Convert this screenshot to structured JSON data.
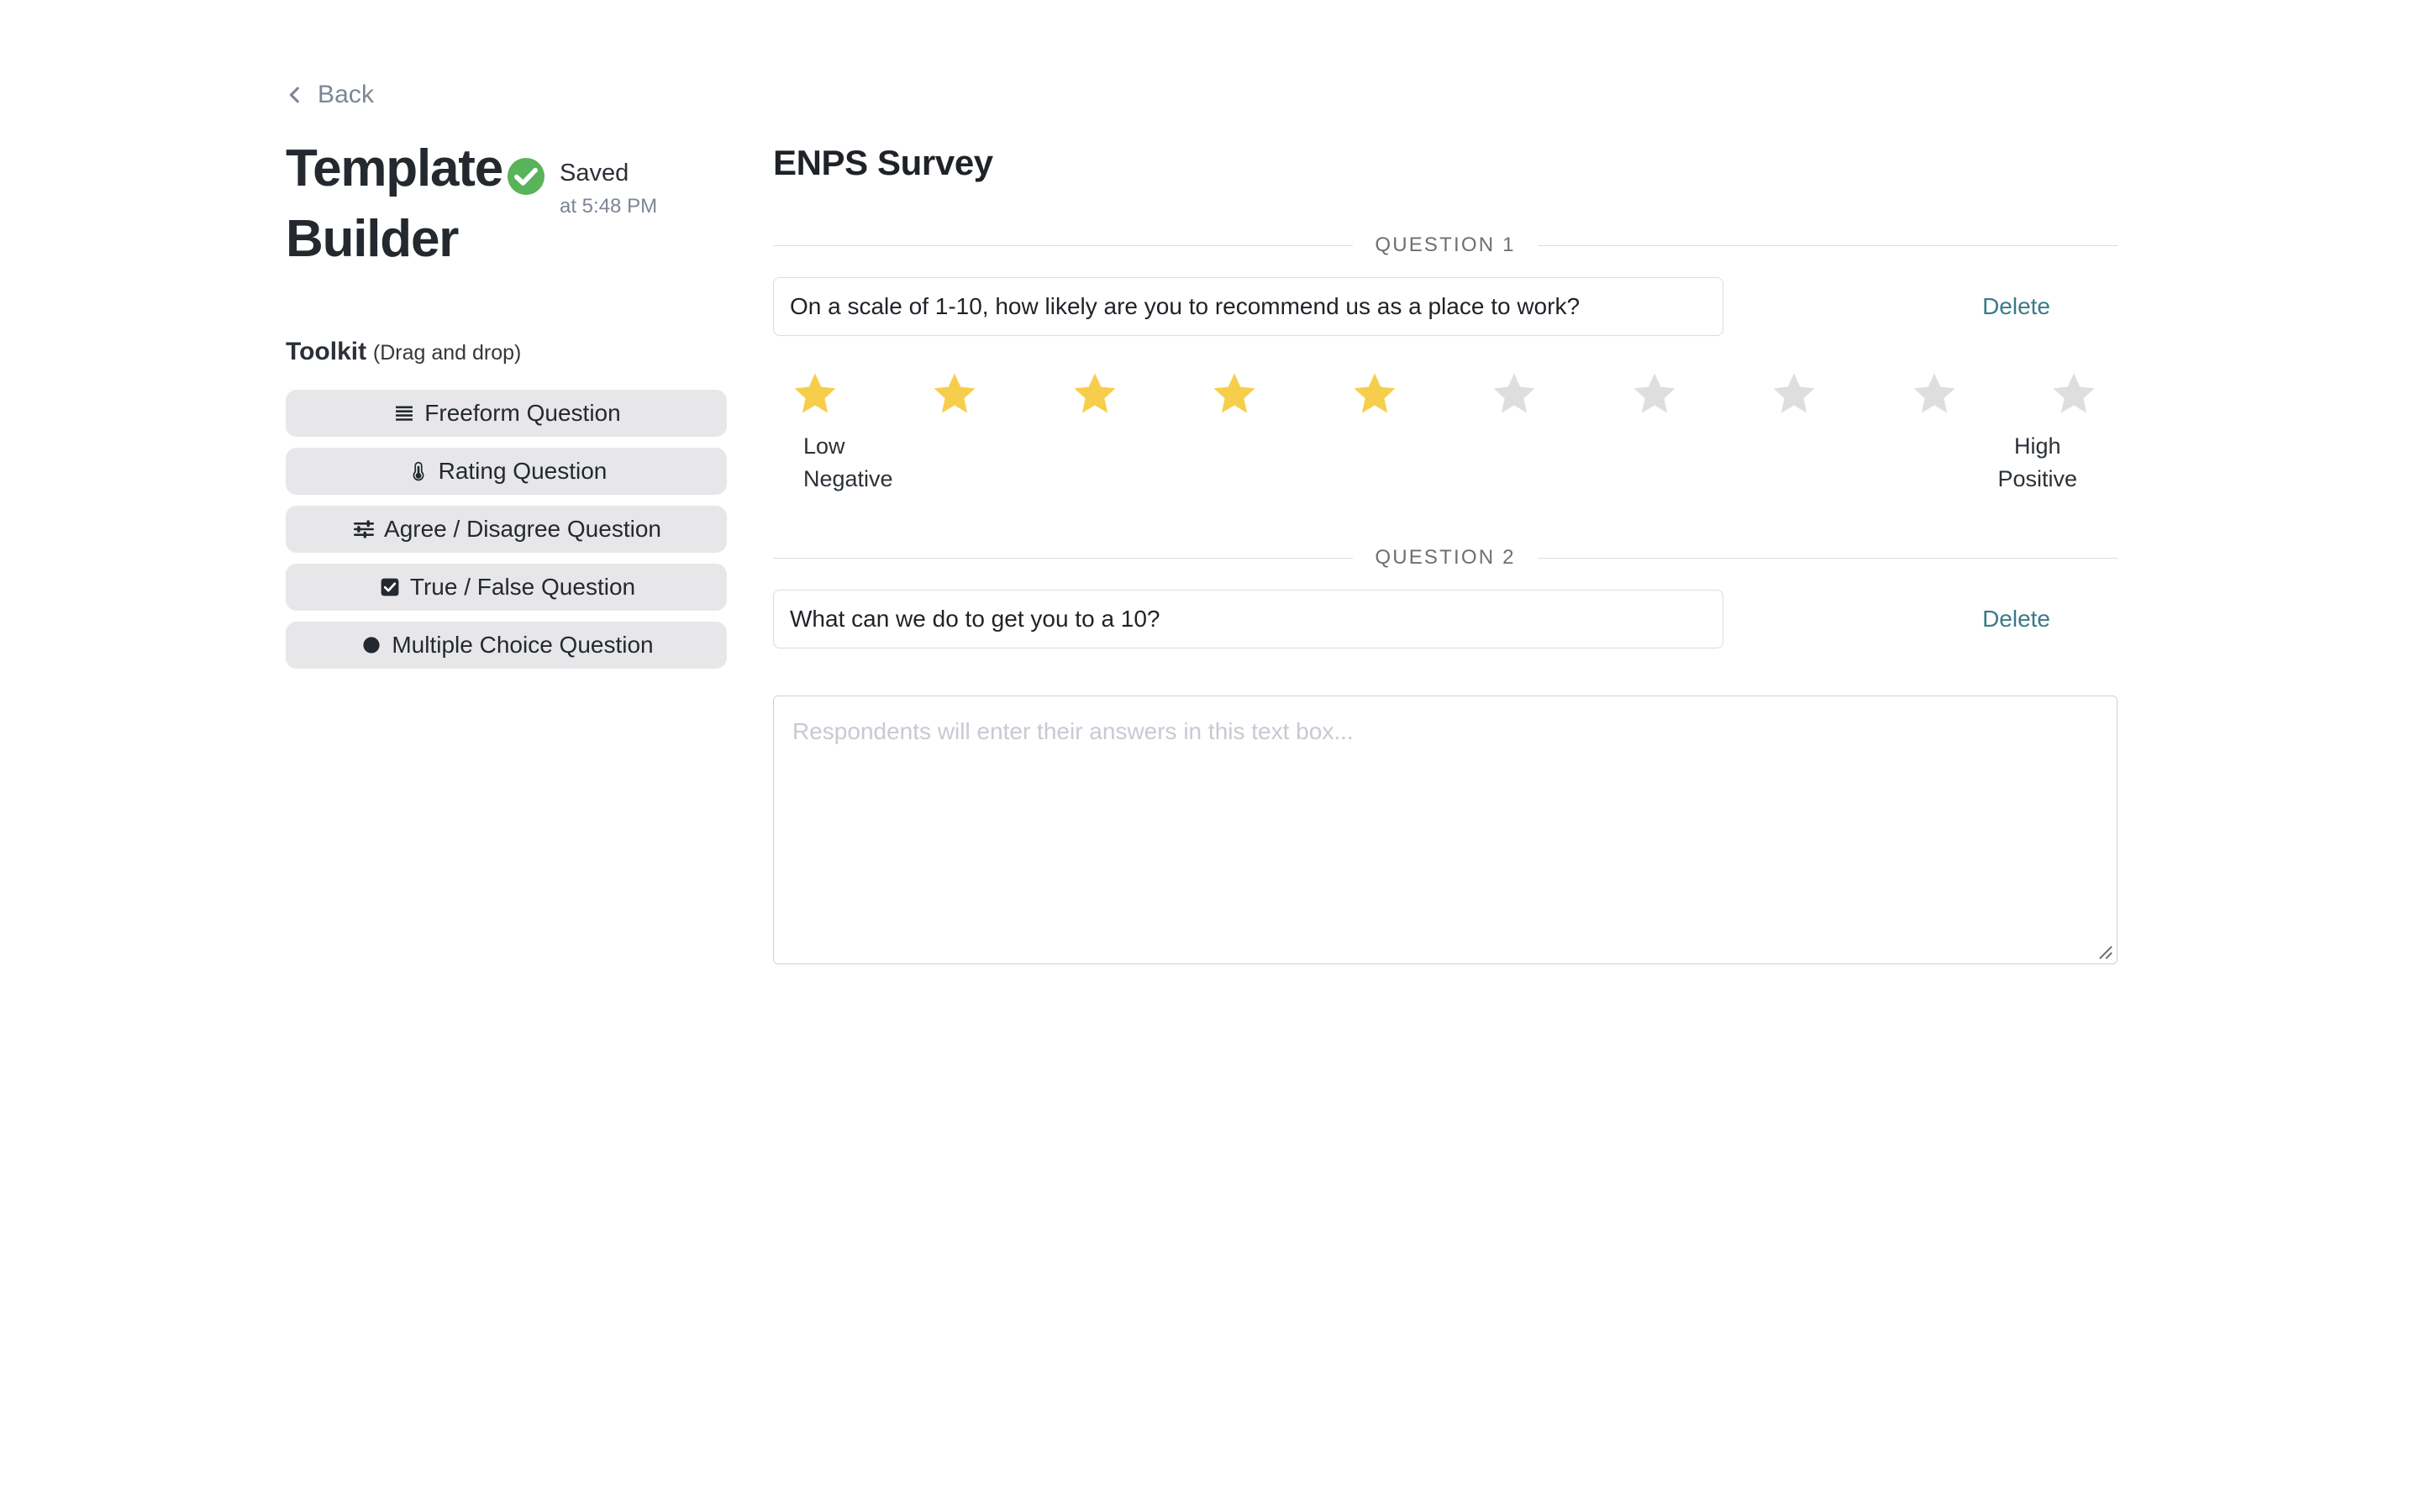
{
  "sidebar": {
    "back_label": "Back",
    "back_icon": "chevron-left-icon",
    "title_line1": "Template",
    "title_line2": "Builder",
    "saved_icon": "check-circle-icon",
    "saved_label": "Saved",
    "saved_time": "at 5:48 PM",
    "toolkit_heading": "Toolkit",
    "toolkit_hint": "(Drag and drop)",
    "tools": [
      {
        "label": "Freeform Question",
        "icon": "list-lines-icon"
      },
      {
        "label": "Rating Question",
        "icon": "thermometer-icon"
      },
      {
        "label": "Agree / Disagree Question",
        "icon": "sliders-icon"
      },
      {
        "label": "True / False Question",
        "icon": "checkbox-checked-icon"
      },
      {
        "label": "Multiple Choice Question",
        "icon": "filled-circle-icon"
      }
    ]
  },
  "main": {
    "survey_title": "ENPS Survey",
    "questions": [
      {
        "divider_label": "QUESTION 1",
        "text": "On a scale of 1-10, how likely are you to recommend us as a place to work?",
        "delete_label": "Delete",
        "type": "rating",
        "rating": {
          "total_stars": 10,
          "filled_stars": 5,
          "low_line1": "Low",
          "low_line2": "Negative",
          "high_line1": "High",
          "high_line2": "Positive"
        }
      },
      {
        "divider_label": "QUESTION 2",
        "text": "What can we do to get you to a 10?",
        "delete_label": "Delete",
        "type": "freeform",
        "answer_placeholder": "Respondents will enter their answers in this text box..."
      }
    ]
  },
  "colors": {
    "star_filled": "#f7ce4b",
    "star_empty": "#dedede",
    "saved_green": "#58b35a",
    "delete_teal": "#3b7a8a",
    "tool_bg": "#e7e7e9",
    "text_dark": "#24292f",
    "muted": "#7d8694"
  }
}
